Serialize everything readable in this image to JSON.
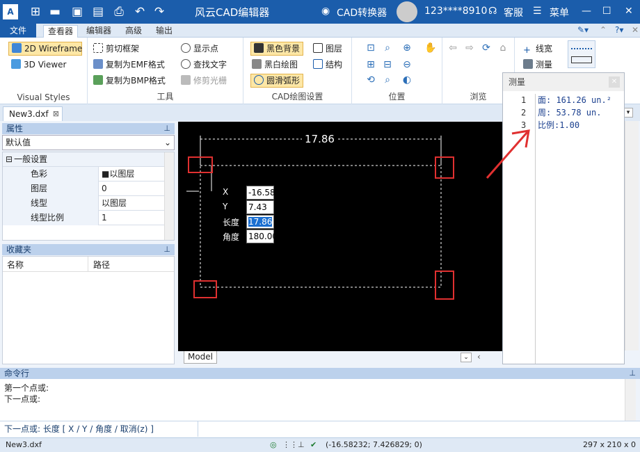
{
  "app": {
    "title": "风云CAD编辑器",
    "converter_label": "CAD转换器",
    "user": "123****8910",
    "service_label": "客服",
    "menu_label": "菜单"
  },
  "ribbon_tabs": [
    "文件",
    "查看器",
    "编辑器",
    "高级",
    "输出"
  ],
  "ribbon": {
    "visual_styles": {
      "items": [
        "2D Wireframe",
        "3D Viewer"
      ],
      "label": "Visual Styles"
    },
    "tools": {
      "items": [
        "剪切框架",
        "复制为EMF格式",
        "复制为BMP格式",
        "显示点",
        "查找文字",
        "修剪光栅"
      ],
      "label": "工具"
    },
    "cad_settings": {
      "items": [
        "黑色背景",
        "黑白绘图",
        "圆滑弧形",
        "图层",
        "结构"
      ],
      "label": "CAD绘图设置"
    },
    "position": {
      "label": "位置"
    },
    "browse": {
      "label": "浏览"
    },
    "tools2": {
      "items": [
        "线宽",
        "测量"
      ]
    }
  },
  "doc_tab": "New3.dxf",
  "properties": {
    "header": "属性",
    "selector": "默认值",
    "section": "一般设置",
    "rows": [
      {
        "k": "色彩",
        "v": "■以图层"
      },
      {
        "k": "图层",
        "v": "0"
      },
      {
        "k": "线型",
        "v": "以图层"
      },
      {
        "k": "线型比例",
        "v": "1"
      }
    ]
  },
  "favorites": {
    "header": "收藏夹",
    "col_name": "名称",
    "col_path": "路径"
  },
  "canvas": {
    "dimension": "17.86",
    "fields": [
      {
        "label": "X",
        "value": "-16.58"
      },
      {
        "label": "Y",
        "value": "7.43"
      },
      {
        "label": "长度",
        "value": "17.86"
      },
      {
        "label": "角度",
        "value": "180.00"
      }
    ],
    "model_tab": "Model"
  },
  "measure": {
    "title": "测量",
    "lines": [
      {
        "n": "1",
        "text": "面: 161.26 un.²"
      },
      {
        "n": "2",
        "text": "周: 53.78 un."
      },
      {
        "n": "3",
        "text": "比例:1.00"
      }
    ]
  },
  "command": {
    "header": "命令行",
    "history": [
      "第一个点或:",
      "下一点或:"
    ],
    "prompt": "下一点或: 长度 [ X / Y / 角度 / 取消(z) ]"
  },
  "status": {
    "file": "New3.dxf",
    "coords": "(-16.58232; 7.426829; 0)",
    "size": "297 x 210 x 0"
  },
  "colors": {
    "accent": "#1b5dab",
    "highlight": "#e03030"
  }
}
